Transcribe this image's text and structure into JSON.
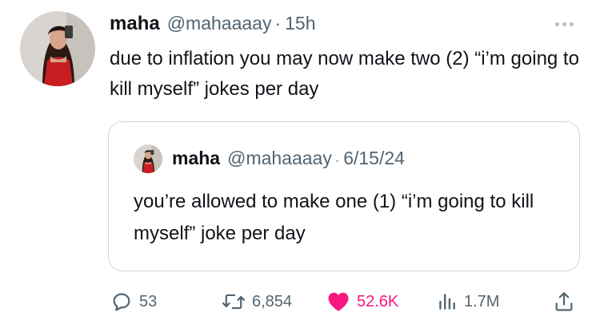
{
  "tweet": {
    "author_name": "maha",
    "handle": "@mahaaaay",
    "separator": "·",
    "time": "15h",
    "text": "due to inflation you may now make two (2) “i’m going to kill myself” jokes per day"
  },
  "quoted_tweet": {
    "author_name": "maha",
    "handle": "@mahaaaay",
    "separator": "·",
    "date": "6/15/24",
    "text": "you’re allowed to make one (1) “i’m going to kill myself” joke per day"
  },
  "actions": {
    "replies": "53",
    "retweets": "6,854",
    "likes": "52.6K",
    "views": "1.7M"
  },
  "icons": {
    "more": "more-horizontal-icon",
    "reply": "reply-bubble-icon",
    "retweet": "retweet-icon",
    "like": "heart-filled-icon",
    "views": "views-bar-chart-icon",
    "share": "share-upload-icon"
  },
  "colors": {
    "text_primary": "#0f1419",
    "text_secondary": "#536471",
    "like_active": "#f91880",
    "border": "#cfd9de"
  }
}
